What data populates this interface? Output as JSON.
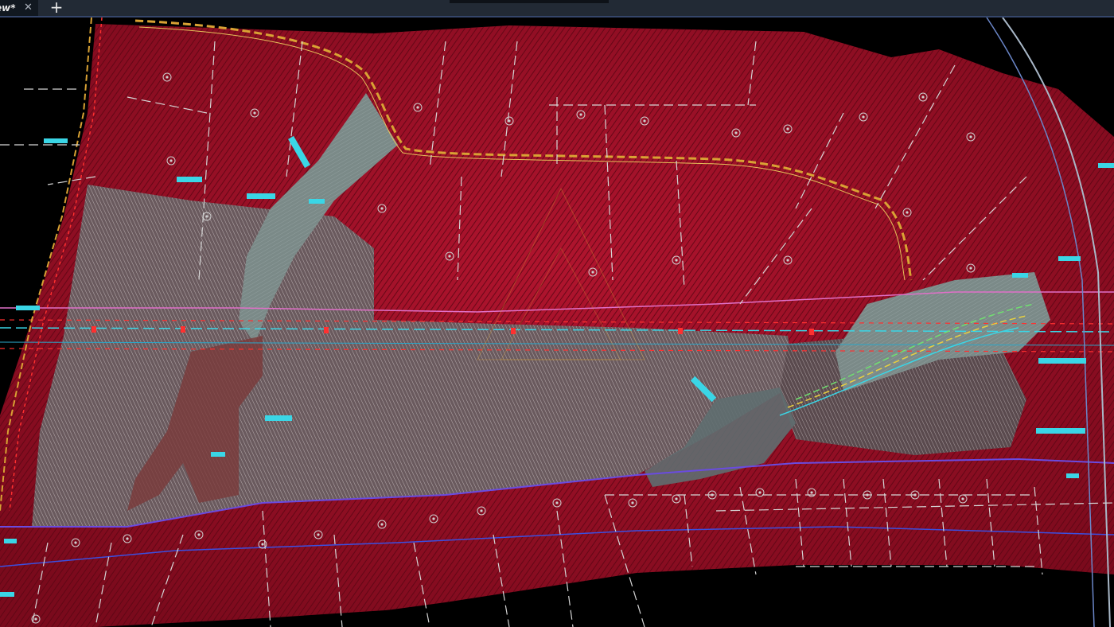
{
  "window": {
    "tab_title": "ew*",
    "close_glyph": "✕",
    "add_glyph": "+"
  },
  "icons": {
    "close": "close-icon",
    "add": "plus-icon"
  },
  "colors": {
    "background": "#000000",
    "terrain": "#a3102a",
    "contours": "#e8e4e4",
    "road": "#d9a234",
    "pipeline": "#3ad6e6",
    "boundary": "#5a4bd8",
    "parcel_lines": "#cfcfcf"
  }
}
